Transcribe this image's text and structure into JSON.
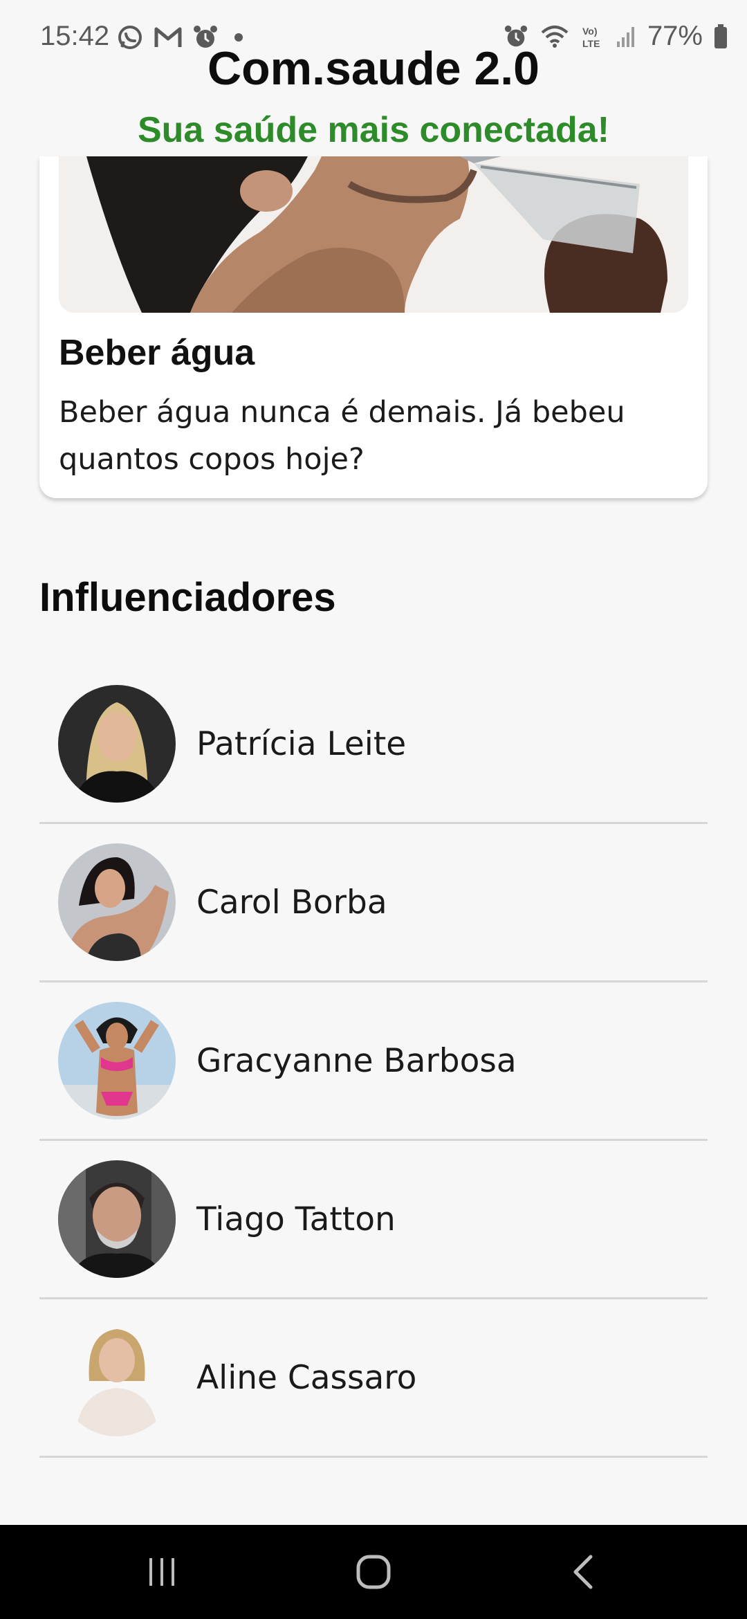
{
  "status_bar": {
    "time": "15:42",
    "battery": "77%",
    "left_icons": [
      "whatsapp-icon",
      "gmail-icon",
      "alarm-icon",
      "dot-icon"
    ],
    "right_icons": [
      "alarm-icon",
      "wifi-icon",
      "volte-icon",
      "signal-icon",
      "battery-icon"
    ]
  },
  "header": {
    "title": "Com.saude 2.0",
    "subtitle": "Sua saúde mais conectada!"
  },
  "card": {
    "title": "Beber água",
    "text": "Beber água nunca é demais. Já bebeu quantos copos hoje?"
  },
  "influencers": {
    "title": "Influenciadores",
    "items": [
      {
        "name": "Patrícia Leite"
      },
      {
        "name": "Carol Borba"
      },
      {
        "name": "Gracyanne Barbosa"
      },
      {
        "name": "Tiago Tatton"
      },
      {
        "name": "Aline Cassaro"
      }
    ]
  },
  "colors": {
    "subtitle_green": "#2e8b2a",
    "background": "#f7f7f7",
    "nav_bar": "#000000"
  }
}
